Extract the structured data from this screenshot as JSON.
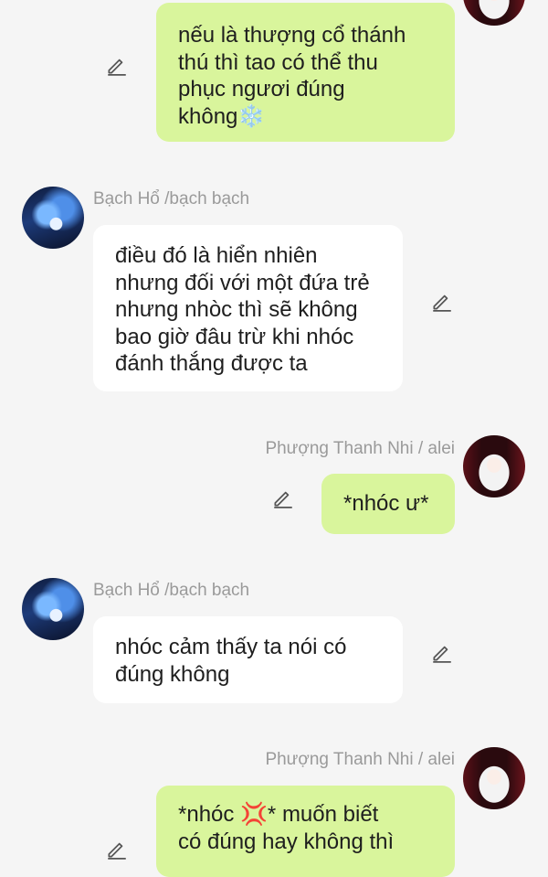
{
  "messages": [
    {
      "id": "m1",
      "direction": "out",
      "sender": "",
      "lines": [
        "nếu là thượng cổ thánh",
        "thú thì tao có thể thu",
        "phục ngươi đúng",
        "không❄️"
      ]
    },
    {
      "id": "m2",
      "direction": "in",
      "sender": "Bạch Hổ /bạch bạch",
      "lines": [
        "điều đó là hiển nhiên",
        "nhưng đối với một đứa trẻ",
        "nhưng nhòc thì sẽ không",
        "bao giờ đâu trừ khi nhóc",
        "đánh thắng được ta"
      ]
    },
    {
      "id": "m3",
      "direction": "out",
      "sender": "Phượng Thanh Nhi / alei",
      "lines": [
        "*nhóc ư*"
      ]
    },
    {
      "id": "m4",
      "direction": "in",
      "sender": "Bạch Hổ /bạch bạch",
      "lines": [
        "nhóc cảm thấy ta nói có",
        "đúng không"
      ]
    },
    {
      "id": "m5",
      "direction": "out",
      "sender": "Phượng Thanh Nhi / alei",
      "lines": [
        "*nhóc 💢* muốn biết",
        "có đúng hay không thì"
      ]
    }
  ],
  "icons": {
    "edit": "pencil-edit-icon",
    "avatar_in": "tiger-avatar",
    "avatar_out": "girl-avatar"
  },
  "colors": {
    "background": "#f5f5f5",
    "incoming_bubble": "#ffffff",
    "outgoing_bubble": "#d9f59c",
    "sender_name": "#9a9a9a",
    "text": "#1e1e1e"
  }
}
